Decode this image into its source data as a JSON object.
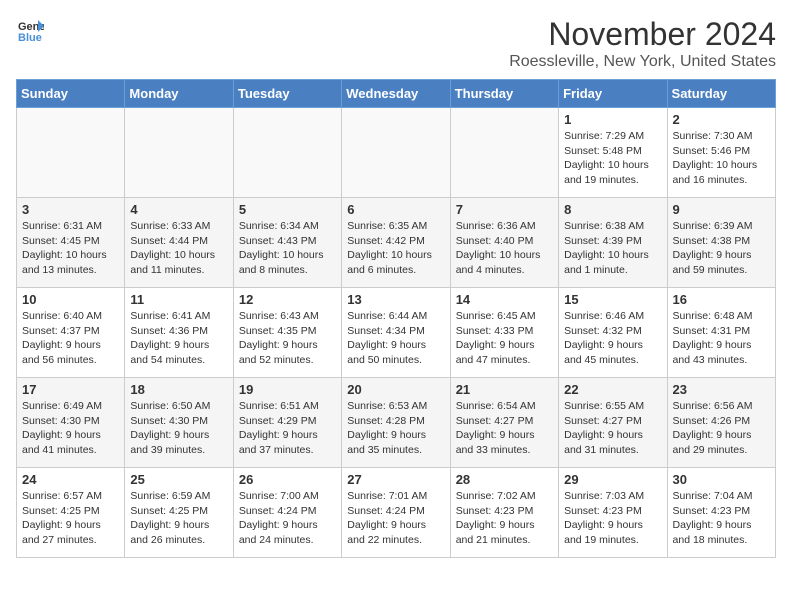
{
  "header": {
    "logo_line1": "General",
    "logo_line2": "Blue",
    "month_title": "November 2024",
    "location": "Roessleville, New York, United States"
  },
  "weekdays": [
    "Sunday",
    "Monday",
    "Tuesday",
    "Wednesday",
    "Thursday",
    "Friday",
    "Saturday"
  ],
  "weeks": [
    [
      {
        "day": "",
        "info": ""
      },
      {
        "day": "",
        "info": ""
      },
      {
        "day": "",
        "info": ""
      },
      {
        "day": "",
        "info": ""
      },
      {
        "day": "",
        "info": ""
      },
      {
        "day": "1",
        "info": "Sunrise: 7:29 AM\nSunset: 5:48 PM\nDaylight: 10 hours and 19 minutes."
      },
      {
        "day": "2",
        "info": "Sunrise: 7:30 AM\nSunset: 5:46 PM\nDaylight: 10 hours and 16 minutes."
      }
    ],
    [
      {
        "day": "3",
        "info": "Sunrise: 6:31 AM\nSunset: 4:45 PM\nDaylight: 10 hours and 13 minutes."
      },
      {
        "day": "4",
        "info": "Sunrise: 6:33 AM\nSunset: 4:44 PM\nDaylight: 10 hours and 11 minutes."
      },
      {
        "day": "5",
        "info": "Sunrise: 6:34 AM\nSunset: 4:43 PM\nDaylight: 10 hours and 8 minutes."
      },
      {
        "day": "6",
        "info": "Sunrise: 6:35 AM\nSunset: 4:42 PM\nDaylight: 10 hours and 6 minutes."
      },
      {
        "day": "7",
        "info": "Sunrise: 6:36 AM\nSunset: 4:40 PM\nDaylight: 10 hours and 4 minutes."
      },
      {
        "day": "8",
        "info": "Sunrise: 6:38 AM\nSunset: 4:39 PM\nDaylight: 10 hours and 1 minute."
      },
      {
        "day": "9",
        "info": "Sunrise: 6:39 AM\nSunset: 4:38 PM\nDaylight: 9 hours and 59 minutes."
      }
    ],
    [
      {
        "day": "10",
        "info": "Sunrise: 6:40 AM\nSunset: 4:37 PM\nDaylight: 9 hours and 56 minutes."
      },
      {
        "day": "11",
        "info": "Sunrise: 6:41 AM\nSunset: 4:36 PM\nDaylight: 9 hours and 54 minutes."
      },
      {
        "day": "12",
        "info": "Sunrise: 6:43 AM\nSunset: 4:35 PM\nDaylight: 9 hours and 52 minutes."
      },
      {
        "day": "13",
        "info": "Sunrise: 6:44 AM\nSunset: 4:34 PM\nDaylight: 9 hours and 50 minutes."
      },
      {
        "day": "14",
        "info": "Sunrise: 6:45 AM\nSunset: 4:33 PM\nDaylight: 9 hours and 47 minutes."
      },
      {
        "day": "15",
        "info": "Sunrise: 6:46 AM\nSunset: 4:32 PM\nDaylight: 9 hours and 45 minutes."
      },
      {
        "day": "16",
        "info": "Sunrise: 6:48 AM\nSunset: 4:31 PM\nDaylight: 9 hours and 43 minutes."
      }
    ],
    [
      {
        "day": "17",
        "info": "Sunrise: 6:49 AM\nSunset: 4:30 PM\nDaylight: 9 hours and 41 minutes."
      },
      {
        "day": "18",
        "info": "Sunrise: 6:50 AM\nSunset: 4:30 PM\nDaylight: 9 hours and 39 minutes."
      },
      {
        "day": "19",
        "info": "Sunrise: 6:51 AM\nSunset: 4:29 PM\nDaylight: 9 hours and 37 minutes."
      },
      {
        "day": "20",
        "info": "Sunrise: 6:53 AM\nSunset: 4:28 PM\nDaylight: 9 hours and 35 minutes."
      },
      {
        "day": "21",
        "info": "Sunrise: 6:54 AM\nSunset: 4:27 PM\nDaylight: 9 hours and 33 minutes."
      },
      {
        "day": "22",
        "info": "Sunrise: 6:55 AM\nSunset: 4:27 PM\nDaylight: 9 hours and 31 minutes."
      },
      {
        "day": "23",
        "info": "Sunrise: 6:56 AM\nSunset: 4:26 PM\nDaylight: 9 hours and 29 minutes."
      }
    ],
    [
      {
        "day": "24",
        "info": "Sunrise: 6:57 AM\nSunset: 4:25 PM\nDaylight: 9 hours and 27 minutes."
      },
      {
        "day": "25",
        "info": "Sunrise: 6:59 AM\nSunset: 4:25 PM\nDaylight: 9 hours and 26 minutes."
      },
      {
        "day": "26",
        "info": "Sunrise: 7:00 AM\nSunset: 4:24 PM\nDaylight: 9 hours and 24 minutes."
      },
      {
        "day": "27",
        "info": "Sunrise: 7:01 AM\nSunset: 4:24 PM\nDaylight: 9 hours and 22 minutes."
      },
      {
        "day": "28",
        "info": "Sunrise: 7:02 AM\nSunset: 4:23 PM\nDaylight: 9 hours and 21 minutes."
      },
      {
        "day": "29",
        "info": "Sunrise: 7:03 AM\nSunset: 4:23 PM\nDaylight: 9 hours and 19 minutes."
      },
      {
        "day": "30",
        "info": "Sunrise: 7:04 AM\nSunset: 4:23 PM\nDaylight: 9 hours and 18 minutes."
      }
    ]
  ]
}
